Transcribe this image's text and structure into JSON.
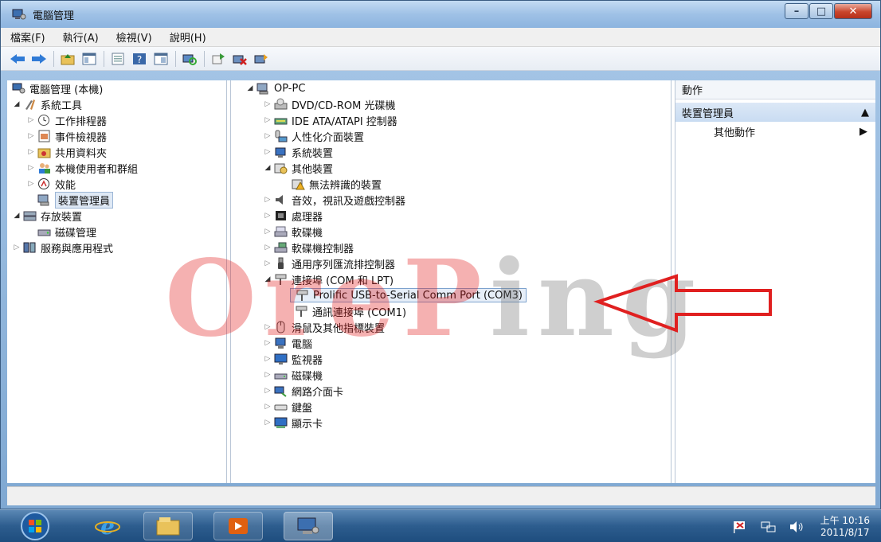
{
  "window": {
    "title": "電腦管理",
    "controls": [
      "minimize-icon",
      "maximize-icon",
      "close-icon"
    ]
  },
  "menu": [
    "檔案(F)",
    "執行(A)",
    "檢視(V)",
    "說明(H)"
  ],
  "toolbar_icons": [
    "back-arrow-icon",
    "forward-arrow-icon",
    "up-folder-icon",
    "show-hide-tree-icon",
    "properties-icon",
    "help-icon",
    "console-icon",
    "scan-hardware-icon",
    "update-driver-icon",
    "disable-device-icon",
    "uninstall-device-icon"
  ],
  "left_tree": {
    "root": "電腦管理 (本機)",
    "system_tools": "系統工具",
    "task_scheduler": "工作排程器",
    "event_viewer": "事件檢視器",
    "shared_folders": "共用資料夾",
    "local_users": "本機使用者和群組",
    "performance": "效能",
    "device_manager": "裝置管理員",
    "storage": "存放裝置",
    "disk_management": "磁碟管理",
    "services_apps": "服務與應用程式"
  },
  "device_tree": {
    "computer": "OP-PC",
    "dvd": "DVD/CD-ROM 光碟機",
    "ide": "IDE ATA/ATAPI 控制器",
    "hid": "人性化介面裝置",
    "system_devices": "系統裝置",
    "other_devices": "其他裝置",
    "unknown_device": "無法辨識的裝置",
    "sound": "音效，視訊及遊戲控制器",
    "processors": "處理器",
    "disk_drives": "軟碟機",
    "floppy_controllers": "軟碟機控制器",
    "usb_controllers": "通用序列匯流排控制器",
    "ports": "連接埠 (COM 和 LPT)",
    "prolific_port": "Prolific USB-to-Serial Comm Port (COM3)",
    "com1": "通訊連接埠 (COM1)",
    "mice": "滑鼠及其他指標裝置",
    "computer_node": "電腦",
    "monitors": "監視器",
    "disk": "磁碟機",
    "network": "網路介面卡",
    "keyboards": "鍵盤",
    "display": "顯示卡"
  },
  "actions": {
    "header": "動作",
    "section": "裝置管理員",
    "more": "其他動作"
  },
  "taskbar": {
    "time": "上午 10:16",
    "date": "2011/8/17"
  },
  "watermark": {
    "red_part": "OreP",
    "gray_part": "ing"
  },
  "colors": {
    "annotation_arrow": "#e02020",
    "taskbar": "#2d5d8e",
    "selection": "#dfe9f5"
  }
}
